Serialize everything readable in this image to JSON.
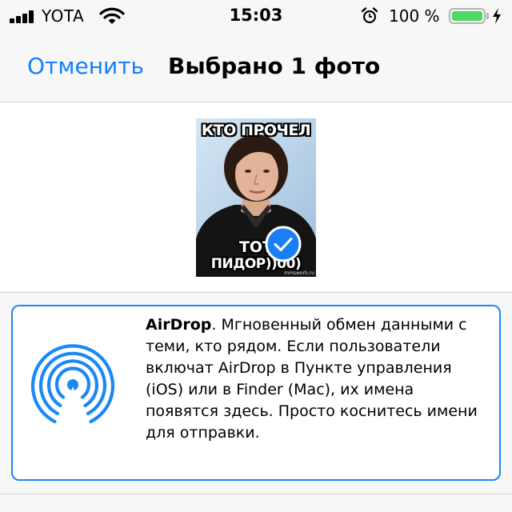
{
  "status_bar": {
    "carrier": "YOTA",
    "time": "15:03",
    "battery_percent": "100 %",
    "battery_level": 1.0
  },
  "nav": {
    "cancel_label": "Отменить",
    "title": "Выбрано 1 фото"
  },
  "photo": {
    "top_caption": "КТО ПРОЧЕЛ",
    "bottom_caption_1": "ТОТ",
    "bottom_caption_2": "ПИДОР))00)",
    "watermark": "mmsworb.ru",
    "selected": true
  },
  "airdrop": {
    "title": "AirDrop",
    "description": ". Мгновенный обмен данными с теми, кто рядом. Если пользователи включат AirDrop в Пункте управления (iOS) или в Finder (Mac), их имена появятся здесь. Просто коснитесь имени для отправки."
  },
  "colors": {
    "accent": "#147efb",
    "battery": "#4cd964",
    "card_border": "#1a88f5"
  },
  "icons": [
    "signal-icon",
    "wifi-icon",
    "alarm-icon",
    "battery-icon",
    "charging-icon",
    "checkmark-icon",
    "airdrop-icon"
  ]
}
